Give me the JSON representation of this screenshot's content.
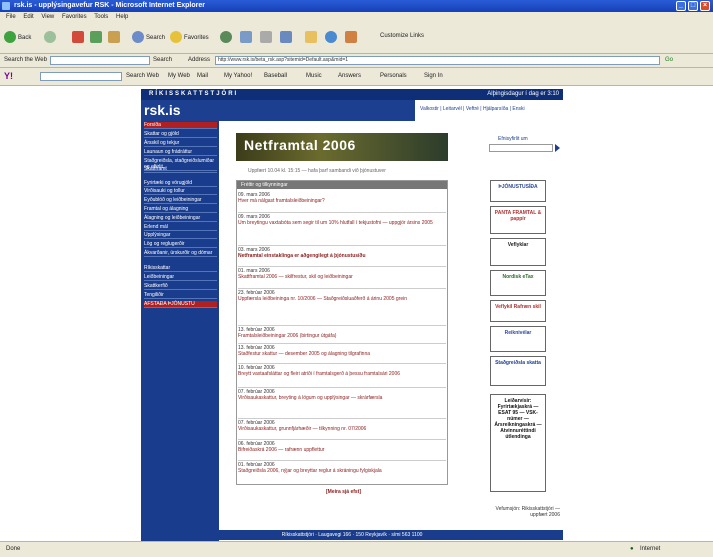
{
  "window": {
    "title": "rsk.is - upplýsingavefur RSK - Microsoft Internet Explorer"
  },
  "menu": [
    "File",
    "Edit",
    "View",
    "Favorites",
    "Tools",
    "Help"
  ],
  "toolbar": {
    "back": "Back",
    "search": "Search",
    "favorites": "Favorites",
    "customize": "Customize Links"
  },
  "address": {
    "label": "Address",
    "url": "http://www.rsk.is/beta_rsk.asp?sitemid=Default.asp&mid=1",
    "go": "Go",
    "search_web_label": "Search the Web",
    "search_btn": "Search"
  },
  "yahoo": {
    "search_web": "Search Web",
    "items": [
      "My Web",
      "Mail",
      "My Yahoo!",
      "Baseball",
      "Music",
      "Answers",
      "Personals",
      "Sign In"
    ]
  },
  "site": {
    "header_left": "RÍKISSKATTSTJÓRI",
    "header_right": "Alþingisdagur í dag er 3:10",
    "logo": "rsk.is",
    "toplinks": "Valkostir | Leitarvél | Veftré | Hjálparsíða | Enski",
    "search_label": "Efnisyfirlit um",
    "nav": [
      "Forsíða",
      "Skattar og gjöld",
      "Ársskil og tekjur",
      "Launaun og frádráttur",
      "Staðgreiðsla, staðgreiðslumiðar og eftirlit",
      "Skattframt",
      "Fyrirtæki og vörugjöld",
      "Virðisauki og tollur",
      "Eyðublöð og leiðbeiningar",
      "Framtal og álagning",
      "Álagning og leiðbeiningar",
      "Erlend mál",
      "Upplýsingar",
      "Lög og reglugerðir",
      "Ákvarðanir, úrskurðir og dómar",
      "Ríkisskattar",
      "Leiðbeiningar",
      "Skattkerfið",
      "Tengiliðir",
      "AFSTAÐA ÞJÓNUSTU"
    ],
    "banner": "Netframtal 2006",
    "subline": "Uppfært 10.04 kl. 15:15 — hafa þarf sambandi við þjónustuver",
    "news_header": "Fréttir og tilkynningar",
    "news": [
      {
        "date": "09. mars 2006",
        "title": "Hver má nálgast framtalsleiðbeiningar?",
        "bold": false
      },
      {
        "date": "09. mars 2006",
        "title": "Um breytingu vaxtabóta sem segir til um 10% hlutfall í tekjustofni — uppgjör ársins 2005",
        "bold": false
      },
      {
        "date": "03. mars 2006",
        "title": "Netframtal einstaklinga er aðgengilegt á þjónustusíðu",
        "bold": true
      },
      {
        "date": "01. mars 2006",
        "title": "Skattframtal 2006 — skilfrestur, skil og leiðbeiningar",
        "bold": false
      },
      {
        "date": "23. febrúar 2006",
        "title": "Uppfærsla leiðbeininga nr. 10/2006 — Staðgreiðsluaðferð á árinu 2005 grein",
        "bold": false
      },
      {
        "date": "13. febrúar 2006",
        "title": "Framtalsleiðbeiningar 2006 (birtingur útgáfa)",
        "bold": false
      },
      {
        "date": "13. febrúar 2006",
        "title": "Staðfestur skattur — desember 2005 og álagning tilgrafinna",
        "bold": false
      },
      {
        "date": "10. febrúar 2006",
        "title": "Breytt vaxtaafsláttar og fleiri atriði í framtalsgerð á þessu framtalsári 2006",
        "bold": false
      },
      {
        "date": "07. febrúar 2006",
        "title": "Virðisaukaskattur, breyting á lögum og upplýsingar — skrárfærsla",
        "bold": false
      },
      {
        "date": "07. febrúar 2006",
        "title": "Virðisaukaskattur, grunnfjárhæðir — tilkynning nr. 07/2006",
        "bold": false
      },
      {
        "date": "06. febrúar 2006",
        "title": "Bifreiðaskrá 2006 — rafrænn uppflettur",
        "bold": false
      },
      {
        "date": "01. febrúar 2006",
        "title": "Staðgreiðsla 2006, nýjar og breyttar reglur á skráningu fylgiskjala",
        "bold": false
      }
    ],
    "more": "[Meira sjá efst]",
    "ads": [
      "ÞJÓNUSTUSÍÐA",
      "PANTA FRAMTAL & pappír",
      "Veflyklar",
      "Nordisk eTax",
      "Veflykil Rafræn skil",
      "Reiknivélar",
      "Staðgreiðsla skatta",
      "Leiðarvísir: Fyrirtækjaskrá — ESAT 95 — VSK-númer — Ársreikningaskrá — Atvinnuréttindi útlendinga"
    ],
    "footnote": "Vefumsjón: Rikisskattstjóri — uppfært 2006",
    "footer": "Ríkisskattstjóri · Laugavegi 166 · 150 Reykjavík · sími 563 1100"
  },
  "status": {
    "left": "Done",
    "zone": "Internet"
  }
}
